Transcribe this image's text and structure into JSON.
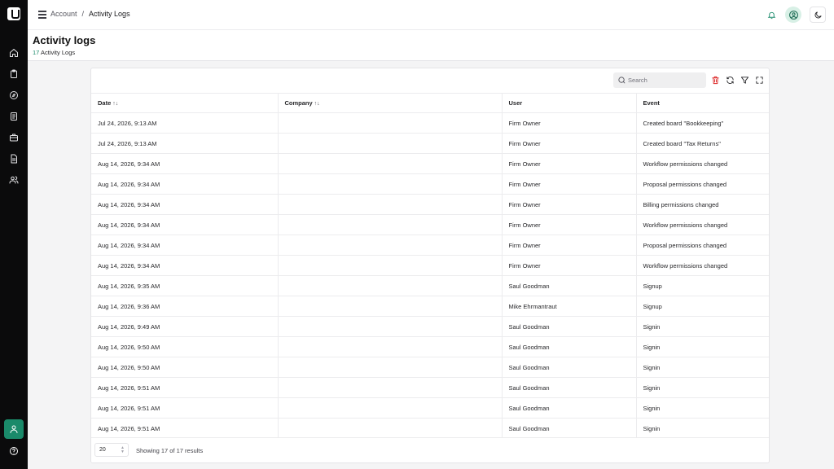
{
  "breadcrumb": {
    "root": "Account",
    "separator": "/",
    "current": "Activity Logs"
  },
  "header": {
    "title": "Activity logs",
    "count": "17",
    "count_label": "Activity Logs"
  },
  "search": {
    "placeholder": "Search",
    "value": ""
  },
  "table": {
    "columns": [
      {
        "label": "Date",
        "sortable": true
      },
      {
        "label": "Company",
        "sortable": true
      },
      {
        "label": "User",
        "sortable": false
      },
      {
        "label": "Event",
        "sortable": false
      }
    ],
    "rows": [
      {
        "date": "Jul 24, 2026, 9:13 AM",
        "company": "",
        "user": "Firm Owner",
        "event": "Created board \"Bookkeeping\""
      },
      {
        "date": "Jul 24, 2026, 9:13 AM",
        "company": "",
        "user": "Firm Owner",
        "event": "Created board \"Tax Returns\""
      },
      {
        "date": "Aug 14, 2026, 9:34 AM",
        "company": "",
        "user": "Firm Owner",
        "event": "Workflow permissions changed"
      },
      {
        "date": "Aug 14, 2026, 9:34 AM",
        "company": "",
        "user": "Firm Owner",
        "event": "Proposal permissions changed"
      },
      {
        "date": "Aug 14, 2026, 9:34 AM",
        "company": "",
        "user": "Firm Owner",
        "event": "Billing permissions changed"
      },
      {
        "date": "Aug 14, 2026, 9:34 AM",
        "company": "",
        "user": "Firm Owner",
        "event": "Workflow permissions changed"
      },
      {
        "date": "Aug 14, 2026, 9:34 AM",
        "company": "",
        "user": "Firm Owner",
        "event": "Proposal permissions changed"
      },
      {
        "date": "Aug 14, 2026, 9:34 AM",
        "company": "",
        "user": "Firm Owner",
        "event": "Workflow permissions changed"
      },
      {
        "date": "Aug 14, 2026, 9:35 AM",
        "company": "",
        "user": "Saul Goodman",
        "event": "Signup"
      },
      {
        "date": "Aug 14, 2026, 9:36 AM",
        "company": "",
        "user": "Mike Ehrmantraut",
        "event": "Signup"
      },
      {
        "date": "Aug 14, 2026, 9:49 AM",
        "company": "",
        "user": "Saul Goodman",
        "event": "Signin"
      },
      {
        "date": "Aug 14, 2026, 9:50 AM",
        "company": "",
        "user": "Saul Goodman",
        "event": "Signin"
      },
      {
        "date": "Aug 14, 2026, 9:50 AM",
        "company": "",
        "user": "Saul Goodman",
        "event": "Signin"
      },
      {
        "date": "Aug 14, 2026, 9:51 AM",
        "company": "",
        "user": "Saul Goodman",
        "event": "Signin"
      },
      {
        "date": "Aug 14, 2026, 9:51 AM",
        "company": "",
        "user": "Saul Goodman",
        "event": "Signin"
      },
      {
        "date": "Aug 14, 2026, 9:51 AM",
        "company": "",
        "user": "Saul Goodman",
        "event": "Signin"
      }
    ]
  },
  "footer": {
    "page_size": "20",
    "results_text": "Showing 17 of 17 results"
  },
  "colors": {
    "accent": "#1a8a6a",
    "danger": "#dc2626",
    "sidebar": "#0b0b0c"
  },
  "icons": {
    "sidebar": [
      "home-icon",
      "clipboard-icon",
      "compass-icon",
      "document-icon",
      "briefcase-icon",
      "file-text-icon",
      "users-icon"
    ],
    "toolbar": [
      "search-icon",
      "trash-icon",
      "refresh-icon",
      "filter-icon",
      "fullscreen-icon"
    ]
  }
}
